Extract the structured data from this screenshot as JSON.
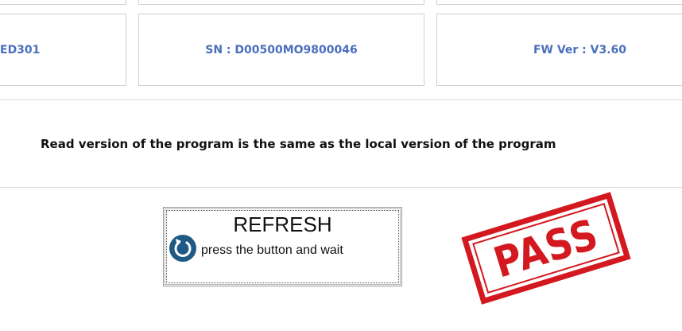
{
  "device_info": {
    "model_partial": "ED301",
    "serial": "SN : D00500MO9800046",
    "firmware": "FW Ver : V3.60"
  },
  "status_message": "Read version of the program is the same as the local version of the program",
  "refresh_button": {
    "title": "REFRESH",
    "subtitle": "press the button and wait",
    "icon": "refresh-icon"
  },
  "result_stamp": {
    "text": "PASS",
    "color": "#d3191f"
  },
  "colors": {
    "info_text": "#4a6fbd",
    "icon_bg": "#1f5a86"
  }
}
